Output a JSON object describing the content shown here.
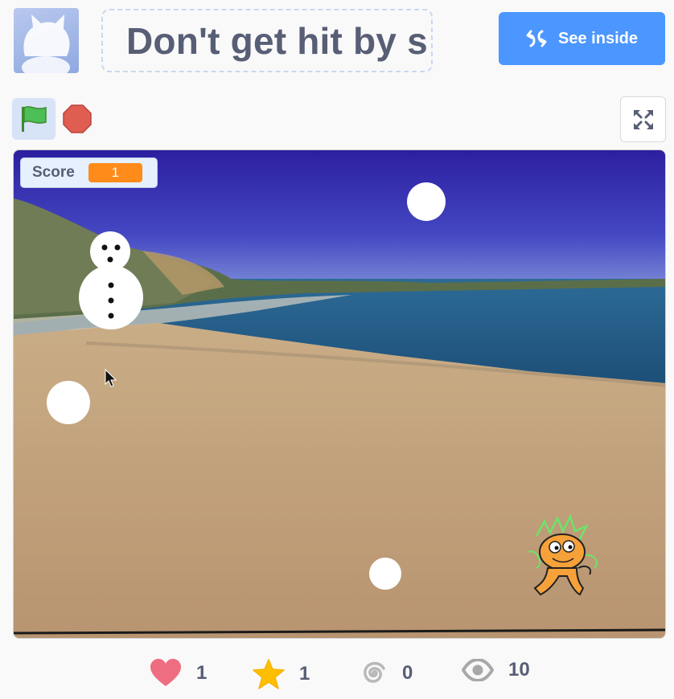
{
  "project": {
    "title": "Don't get hit by s",
    "see_inside_label": "See inside"
  },
  "controls": {
    "green_flag": "green-flag-icon",
    "stop": "stop-icon",
    "fullscreen": "fullscreen-icon"
  },
  "stage": {
    "score_monitor": {
      "label": "Score",
      "value": "1"
    }
  },
  "stats": {
    "loves": "1",
    "favorites": "1",
    "remixes": "0",
    "views": "10"
  },
  "colors": {
    "accent": "#4c97ff",
    "monitor_value": "#ff8c1a",
    "text": "#575e75",
    "love": "#ef6d80",
    "favorite": "#ffbf00",
    "remix": "#b8b8b8",
    "views": "#a8a8a8"
  }
}
